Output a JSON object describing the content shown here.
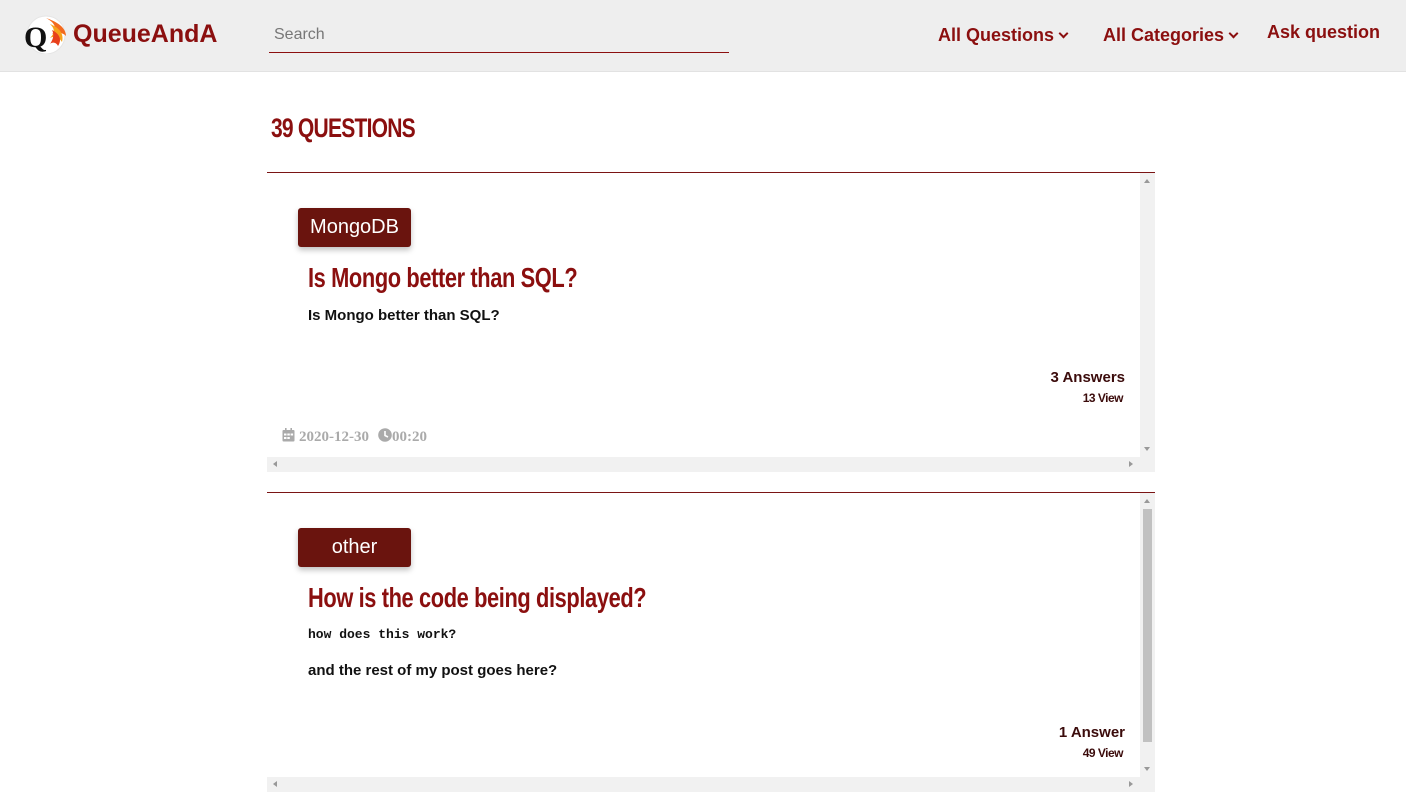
{
  "nav": {
    "brand": "QueueAndA",
    "search_placeholder": "Search",
    "all_questions": "All Questions",
    "all_categories": "All Categories",
    "ask": "Ask question"
  },
  "main": {
    "count_label": "39 QUESTIONS",
    "questions": [
      {
        "tag": "MongoDB",
        "title": "Is Mongo better than SQL?",
        "body": "Is Mongo better than SQL?",
        "answers": "3 Answers",
        "views": "13 View",
        "date": "2020-12-30",
        "time": "00:20"
      },
      {
        "tag": "other",
        "title": "How is the code being displayed?",
        "code": "how does this work?",
        "body": "and the rest of my post goes here?",
        "answers": "1 Answer",
        "views": "49 View"
      }
    ]
  },
  "colors": {
    "accent": "#8b0f0f",
    "tag_bg": "#6a140e",
    "nav_bg": "#eeeeee"
  }
}
